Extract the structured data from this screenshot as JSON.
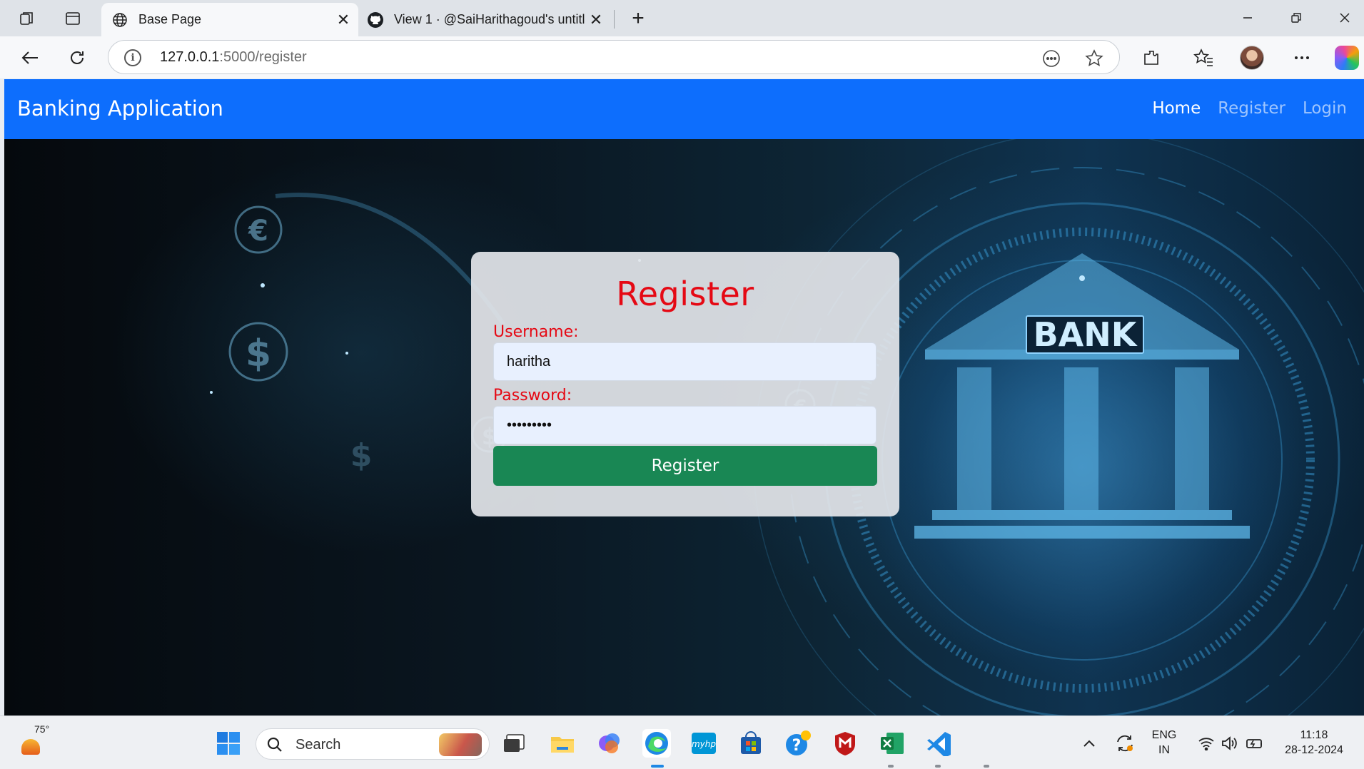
{
  "browser": {
    "tabs": [
      {
        "title": "Base Page",
        "active": true
      },
      {
        "title": "View 1 · @SaiHarithagoud's untitl",
        "active": false
      }
    ],
    "url_host": "127.0.0.1",
    "url_path": ":5000/register"
  },
  "navbar": {
    "brand": "Banking Application",
    "links": [
      "Home",
      "Register",
      "Login"
    ]
  },
  "hero": {
    "bank_sign": "BANK"
  },
  "form": {
    "title": "Register",
    "username_label": "Username:",
    "username_value": "haritha",
    "password_label": "Password:",
    "password_masked": "•••••••••",
    "submit_label": "Register"
  },
  "taskbar": {
    "temperature": "75°",
    "search_placeholder": "Search",
    "lang_top": "ENG",
    "lang_bottom": "IN",
    "time": "11:18",
    "date": "28-12-2024"
  },
  "colors": {
    "navbar": "#0d6efd",
    "title_red": "#e50914",
    "button_green": "#198754"
  }
}
